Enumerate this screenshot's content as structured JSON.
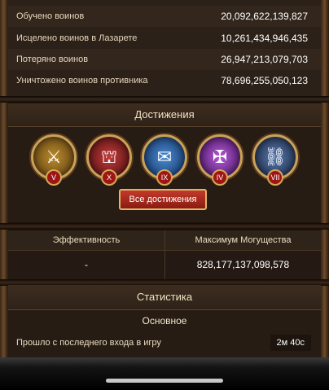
{
  "stats": [
    {
      "label": "Обучено воинов",
      "value": "20,092,622,139,827"
    },
    {
      "label": "Исцелено воинов в Лазарете",
      "value": "10,261,434,946,435"
    },
    {
      "label": "Потеряно воинов",
      "value": "26,947,213,079,703"
    },
    {
      "label": "Уничтожено воинов противника",
      "value": "78,696,255,050,123"
    }
  ],
  "achievements": {
    "title": "Достижения",
    "button": "Все достижения",
    "medals": [
      {
        "roman": "V",
        "icon": "warrior-icon",
        "glyph": "⚔",
        "bg": "#7a5a1c"
      },
      {
        "roman": "X",
        "icon": "fortress-icon",
        "glyph": "⛫",
        "bg": "#8a1e1e"
      },
      {
        "roman": "IX",
        "icon": "scroll-icon",
        "glyph": "📜",
        "bg": "#1d4c8c"
      },
      {
        "roman": "IV",
        "icon": "crossed-swords-icon",
        "glyph": "✠",
        "bg": "#7a2a9a"
      },
      {
        "roman": "VII",
        "icon": "chain-icon",
        "glyph": "⛓",
        "bg": "#2a3f66"
      }
    ]
  },
  "efficiency": {
    "left_header": "Эффективность",
    "left_value": "-",
    "right_header": "Максимум Могущества",
    "right_value": "828,177,137,098,578"
  },
  "statistics": {
    "title": "Статистика",
    "subtitle": "Основное",
    "rows": [
      {
        "label": "Прошло с последнего входа в игру",
        "value": "2м 40с"
      }
    ]
  }
}
